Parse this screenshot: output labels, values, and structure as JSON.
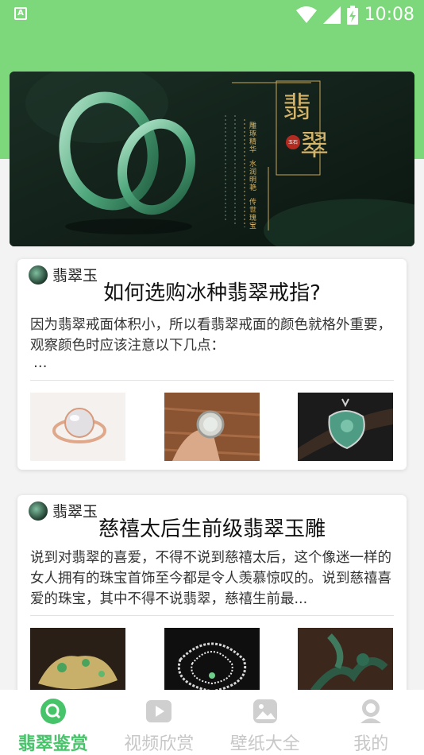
{
  "status_bar": {
    "time": "10:08",
    "app_icon_letter": "A"
  },
  "banner": {
    "title_chars": [
      "翡",
      "翠"
    ],
    "seal_text": "玉石",
    "poem_lines": [
      "雕琢精华",
      "水润明艳",
      "传世瑰宝"
    ]
  },
  "articles": [
    {
      "source": "翡翠玉",
      "title": "如何选购冰种翡翠戒指?",
      "desc": "因为翡翠戒面体积小，所以看翡翠戒面的颜色就格外重要，观察颜色时应该注意以下几点：",
      "desc_more": "…"
    },
    {
      "source": "翡翠玉",
      "title": "慈禧太后生前级翡翠玉雕",
      "desc": "说到对翡翠的喜爱，不得不说到慈禧太后，这个像迷一样的女人拥有的珠宝首饰至今都是令人羡慕惊叹的。说到慈禧喜爱的珠宝，其中不得不说翡翠，慈禧生前最..."
    }
  ],
  "tabs": [
    {
      "label": "翡翠鉴赏",
      "icon": "search-icon",
      "active": true
    },
    {
      "label": "视频欣赏",
      "icon": "play-icon",
      "active": false
    },
    {
      "label": "壁纸大全",
      "icon": "image-icon",
      "active": false
    },
    {
      "label": "我的",
      "icon": "profile-icon",
      "active": false
    }
  ],
  "colors": {
    "accent": "#47c36a",
    "header_green": "#7cd87a",
    "inactive_tab": "#c7c7c7"
  }
}
